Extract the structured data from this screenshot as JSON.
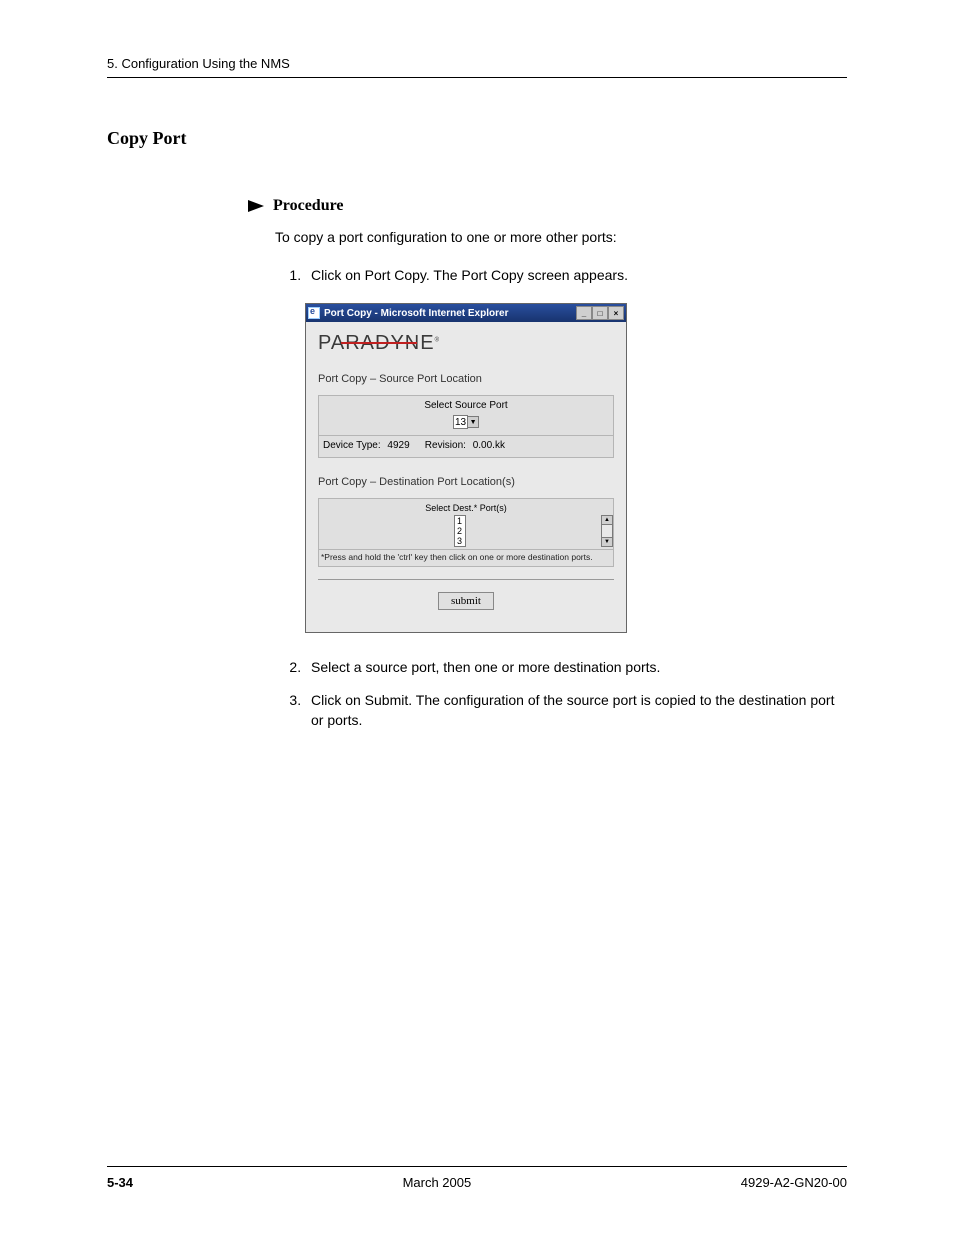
{
  "header": {
    "chapter": "5. Configuration Using the NMS"
  },
  "section": {
    "title": "Copy Port"
  },
  "procedure": {
    "label": "Procedure",
    "intro": "To copy a port configuration to one or more other ports:",
    "step1": "Click on Port Copy. The Port Copy screen appears.",
    "step2": "Select a source port, then one or more destination ports.",
    "step3": "Click on Submit. The configuration of the source port is copied to the destination port or ports."
  },
  "window": {
    "title": "Port Copy - Microsoft Internet Explorer",
    "brand": "PARADYNE",
    "source_title": "Port Copy – Source Port Location",
    "select_source_label": "Select Source Port",
    "source_value": "13",
    "device_type_label": "Device Type:",
    "device_type_value": "4929",
    "revision_label": "Revision:",
    "revision_value": "0.00.kk",
    "dest_title": "Port Copy – Destination Port Location(s)",
    "select_dest_label": "Select Dest.* Port(s)",
    "dest_opt1": "1",
    "dest_opt2": "2",
    "dest_opt3": "3",
    "hint": "*Press and hold the 'ctrl' key then click on one or more destination ports.",
    "submit": "submit"
  },
  "footer": {
    "page": "5-34",
    "date": "March 2005",
    "docnum": "4929-A2-GN20-00"
  }
}
